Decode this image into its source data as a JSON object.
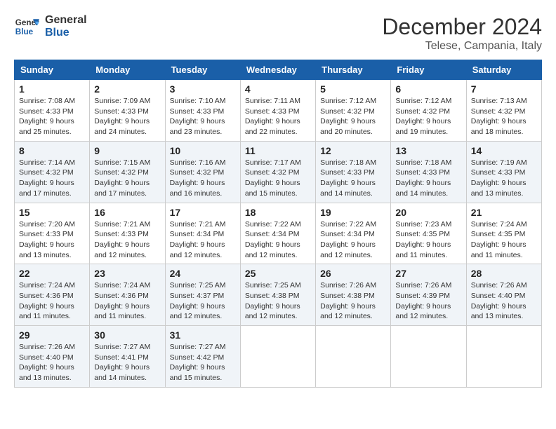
{
  "header": {
    "logo_general": "General",
    "logo_blue": "Blue",
    "month_title": "December 2024",
    "location": "Telese, Campania, Italy"
  },
  "weekdays": [
    "Sunday",
    "Monday",
    "Tuesday",
    "Wednesday",
    "Thursday",
    "Friday",
    "Saturday"
  ],
  "weeks": [
    [
      {
        "day": "1",
        "sunrise": "7:08 AM",
        "sunset": "4:33 PM",
        "daylight": "9 hours and 25 minutes."
      },
      {
        "day": "2",
        "sunrise": "7:09 AM",
        "sunset": "4:33 PM",
        "daylight": "9 hours and 24 minutes."
      },
      {
        "day": "3",
        "sunrise": "7:10 AM",
        "sunset": "4:33 PM",
        "daylight": "9 hours and 23 minutes."
      },
      {
        "day": "4",
        "sunrise": "7:11 AM",
        "sunset": "4:33 PM",
        "daylight": "9 hours and 22 minutes."
      },
      {
        "day": "5",
        "sunrise": "7:12 AM",
        "sunset": "4:32 PM",
        "daylight": "9 hours and 20 minutes."
      },
      {
        "day": "6",
        "sunrise": "7:12 AM",
        "sunset": "4:32 PM",
        "daylight": "9 hours and 19 minutes."
      },
      {
        "day": "7",
        "sunrise": "7:13 AM",
        "sunset": "4:32 PM",
        "daylight": "9 hours and 18 minutes."
      }
    ],
    [
      {
        "day": "8",
        "sunrise": "7:14 AM",
        "sunset": "4:32 PM",
        "daylight": "9 hours and 17 minutes."
      },
      {
        "day": "9",
        "sunrise": "7:15 AM",
        "sunset": "4:32 PM",
        "daylight": "9 hours and 17 minutes."
      },
      {
        "day": "10",
        "sunrise": "7:16 AM",
        "sunset": "4:32 PM",
        "daylight": "9 hours and 16 minutes."
      },
      {
        "day": "11",
        "sunrise": "7:17 AM",
        "sunset": "4:32 PM",
        "daylight": "9 hours and 15 minutes."
      },
      {
        "day": "12",
        "sunrise": "7:18 AM",
        "sunset": "4:33 PM",
        "daylight": "9 hours and 14 minutes."
      },
      {
        "day": "13",
        "sunrise": "7:18 AM",
        "sunset": "4:33 PM",
        "daylight": "9 hours and 14 minutes."
      },
      {
        "day": "14",
        "sunrise": "7:19 AM",
        "sunset": "4:33 PM",
        "daylight": "9 hours and 13 minutes."
      }
    ],
    [
      {
        "day": "15",
        "sunrise": "7:20 AM",
        "sunset": "4:33 PM",
        "daylight": "9 hours and 13 minutes."
      },
      {
        "day": "16",
        "sunrise": "7:21 AM",
        "sunset": "4:33 PM",
        "daylight": "9 hours and 12 minutes."
      },
      {
        "day": "17",
        "sunrise": "7:21 AM",
        "sunset": "4:34 PM",
        "daylight": "9 hours and 12 minutes."
      },
      {
        "day": "18",
        "sunrise": "7:22 AM",
        "sunset": "4:34 PM",
        "daylight": "9 hours and 12 minutes."
      },
      {
        "day": "19",
        "sunrise": "7:22 AM",
        "sunset": "4:34 PM",
        "daylight": "9 hours and 12 minutes."
      },
      {
        "day": "20",
        "sunrise": "7:23 AM",
        "sunset": "4:35 PM",
        "daylight": "9 hours and 11 minutes."
      },
      {
        "day": "21",
        "sunrise": "7:24 AM",
        "sunset": "4:35 PM",
        "daylight": "9 hours and 11 minutes."
      }
    ],
    [
      {
        "day": "22",
        "sunrise": "7:24 AM",
        "sunset": "4:36 PM",
        "daylight": "9 hours and 11 minutes."
      },
      {
        "day": "23",
        "sunrise": "7:24 AM",
        "sunset": "4:36 PM",
        "daylight": "9 hours and 11 minutes."
      },
      {
        "day": "24",
        "sunrise": "7:25 AM",
        "sunset": "4:37 PM",
        "daylight": "9 hours and 12 minutes."
      },
      {
        "day": "25",
        "sunrise": "7:25 AM",
        "sunset": "4:38 PM",
        "daylight": "9 hours and 12 minutes."
      },
      {
        "day": "26",
        "sunrise": "7:26 AM",
        "sunset": "4:38 PM",
        "daylight": "9 hours and 12 minutes."
      },
      {
        "day": "27",
        "sunrise": "7:26 AM",
        "sunset": "4:39 PM",
        "daylight": "9 hours and 12 minutes."
      },
      {
        "day": "28",
        "sunrise": "7:26 AM",
        "sunset": "4:40 PM",
        "daylight": "9 hours and 13 minutes."
      }
    ],
    [
      {
        "day": "29",
        "sunrise": "7:26 AM",
        "sunset": "4:40 PM",
        "daylight": "9 hours and 13 minutes."
      },
      {
        "day": "30",
        "sunrise": "7:27 AM",
        "sunset": "4:41 PM",
        "daylight": "9 hours and 14 minutes."
      },
      {
        "day": "31",
        "sunrise": "7:27 AM",
        "sunset": "4:42 PM",
        "daylight": "9 hours and 15 minutes."
      },
      null,
      null,
      null,
      null
    ]
  ],
  "labels": {
    "sunrise": "Sunrise:",
    "sunset": "Sunset:",
    "daylight": "Daylight:"
  }
}
